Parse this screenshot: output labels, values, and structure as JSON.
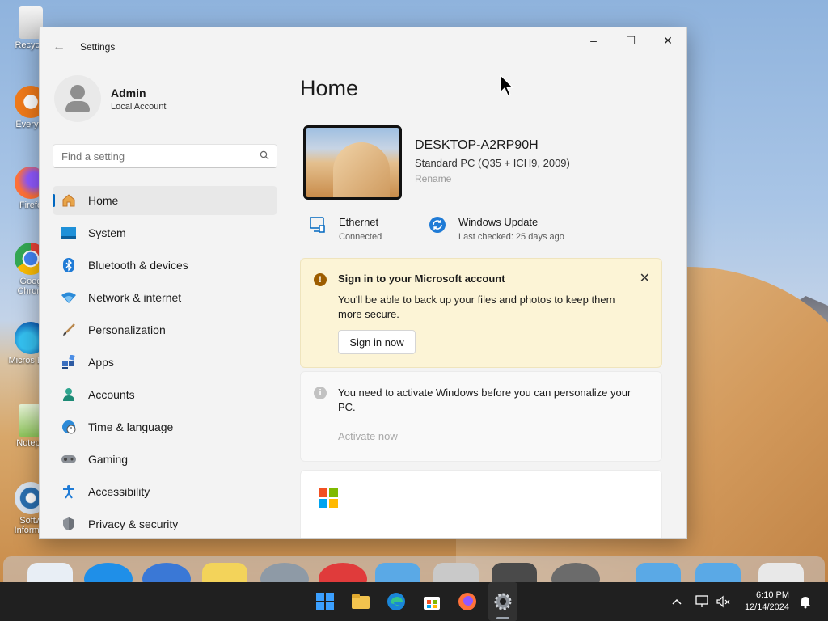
{
  "desktop": {
    "icons": [
      {
        "label": "Recycle"
      },
      {
        "label": "Everyth"
      },
      {
        "label": "Firefo"
      },
      {
        "label": "Goog Chrom"
      },
      {
        "label": "Micros Edg"
      },
      {
        "label": "Notepa"
      },
      {
        "label": "Softw Informer"
      }
    ]
  },
  "window": {
    "title": "Settings",
    "controls": {
      "minimize": "–",
      "maximize": "☐",
      "close": "✕"
    }
  },
  "profile": {
    "name": "Admin",
    "account_type": "Local Account"
  },
  "search": {
    "placeholder": "Find a setting"
  },
  "nav": [
    {
      "label": "Home",
      "icon": "home-icon",
      "active": true
    },
    {
      "label": "System",
      "icon": "system-icon"
    },
    {
      "label": "Bluetooth & devices",
      "icon": "bluetooth-icon"
    },
    {
      "label": "Network & internet",
      "icon": "network-icon"
    },
    {
      "label": "Personalization",
      "icon": "brush-icon"
    },
    {
      "label": "Apps",
      "icon": "apps-icon"
    },
    {
      "label": "Accounts",
      "icon": "accounts-icon"
    },
    {
      "label": "Time & language",
      "icon": "globe-icon"
    },
    {
      "label": "Gaming",
      "icon": "gamepad-icon"
    },
    {
      "label": "Accessibility",
      "icon": "accessibility-icon"
    },
    {
      "label": "Privacy & security",
      "icon": "shield-icon"
    }
  ],
  "main": {
    "title": "Home",
    "device": {
      "name": "DESKTOP-A2RP90H",
      "model": "Standard PC (Q35 + ICH9, 2009)",
      "rename_label": "Rename"
    },
    "status": {
      "ethernet": {
        "title": "Ethernet",
        "subtitle": "Connected"
      },
      "update": {
        "title": "Windows Update",
        "subtitle": "Last checked: 25 days ago"
      }
    },
    "signin_card": {
      "title": "Sign in to your Microsoft account",
      "body": "You'll be able to back up your files and photos to keep them more secure.",
      "button": "Sign in now"
    },
    "activate_card": {
      "body": "You need to activate Windows before you can personalize your PC.",
      "link": "Activate now"
    }
  },
  "taskbar": {
    "clock_time": "6:10 PM",
    "clock_date": "12/14/2024"
  },
  "colors": {
    "accent": "#0067c0",
    "warning_bg": "#fcf4d6",
    "taskbar": "#202020"
  }
}
